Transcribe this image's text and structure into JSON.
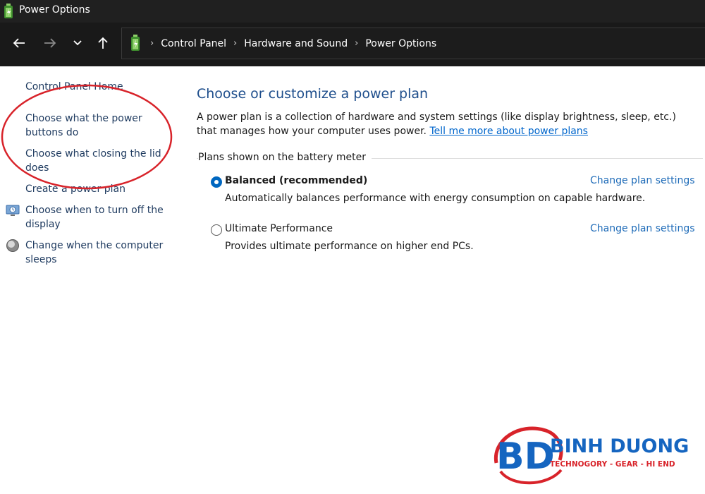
{
  "window": {
    "title": "Power Options"
  },
  "nav": {
    "back_icon": "arrow-left-icon",
    "forward_icon": "arrow-right-icon",
    "recent_icon": "chevron-down-icon",
    "up_icon": "arrow-up-icon"
  },
  "breadcrumb": {
    "items": [
      "Control Panel",
      "Hardware and Sound",
      "Power Options"
    ],
    "separator": "›"
  },
  "sidebar": {
    "home": "Control Panel Home",
    "links": [
      "Choose what the power buttons do",
      "Choose what closing the lid does",
      "Create a power plan",
      "Choose when to turn off the display",
      "Change when the computer sleeps"
    ]
  },
  "main": {
    "title": "Choose or customize a power plan",
    "description": "A power plan is a collection of hardware and system settings (like display brightness, sleep, etc.) that manages how your computer uses power.",
    "learn_more": "Tell me more about power plans",
    "section_label": "Plans shown on the battery meter",
    "plans": [
      {
        "name": "Balanced (recommended)",
        "description": "Automatically balances performance with energy consumption on capable hardware.",
        "selected": true,
        "link": "Change plan settings"
      },
      {
        "name": "Ultimate Performance",
        "description": "Provides ultimate performance on higher end PCs.",
        "selected": false,
        "link": "Change plan settings"
      }
    ]
  },
  "watermark": {
    "brand": "BINH DUONG",
    "tagline": "TECHNOGORY - GEAR - HI END",
    "monogram": "BD"
  },
  "colors": {
    "titlebar_bg": "#202020",
    "navbar_bg": "#191919",
    "link_dark": "#1e3a5f",
    "heading_blue": "#1e4e8c",
    "link_blue": "#1e6bb8",
    "radio_blue": "#0067c0",
    "annotation_red": "#d8232a",
    "brand_blue": "#1565c0"
  }
}
